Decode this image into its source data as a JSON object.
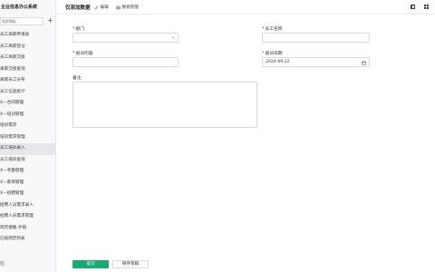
{
  "sidebar": {
    "app_title": "企业信息办公系统",
    "search_placeholder": "搜索模板",
    "add_label": "+",
    "items": [
      {
        "label": "员工离职申请表"
      },
      {
        "label": "员工离职登记"
      },
      {
        "label": "员工离职交接"
      },
      {
        "label": "离职交接查询"
      },
      {
        "label": "离职员工分布"
      },
      {
        "label": "员工信息统计"
      },
      {
        "label": "X—合同管理"
      },
      {
        "label": "X—培训管理"
      },
      {
        "label": "培训需求"
      },
      {
        "label": "培训需求管理"
      },
      {
        "label": "员工培训录入"
      },
      {
        "label": "员工培训查询"
      },
      {
        "label": "X—考勤管理"
      },
      {
        "label": "X—薪资管理"
      },
      {
        "label": "X—招聘管理"
      },
      {
        "label": "招聘人员需求录入"
      },
      {
        "label": "招聘人员需求管理"
      },
      {
        "label": "简历搜集-外链"
      },
      {
        "label": "已投简历列表"
      }
    ],
    "active_index": 10,
    "footer_label": "应"
  },
  "topbar": {
    "title": "仅添加数据",
    "edit_label": "编辑",
    "data_manage_label": "数据管理"
  },
  "form": {
    "department_label": "部门",
    "employee_name_label": "员工名称",
    "training_content_label": "培训内容",
    "training_date_label": "培训日期",
    "training_date_value": "2024-09-22",
    "remarks_label": "备注"
  },
  "actions": {
    "submit_label": "提交",
    "save_draft_label": "保存草稿"
  },
  "colors": {
    "primary": "#19a974",
    "required": "#d03050"
  }
}
